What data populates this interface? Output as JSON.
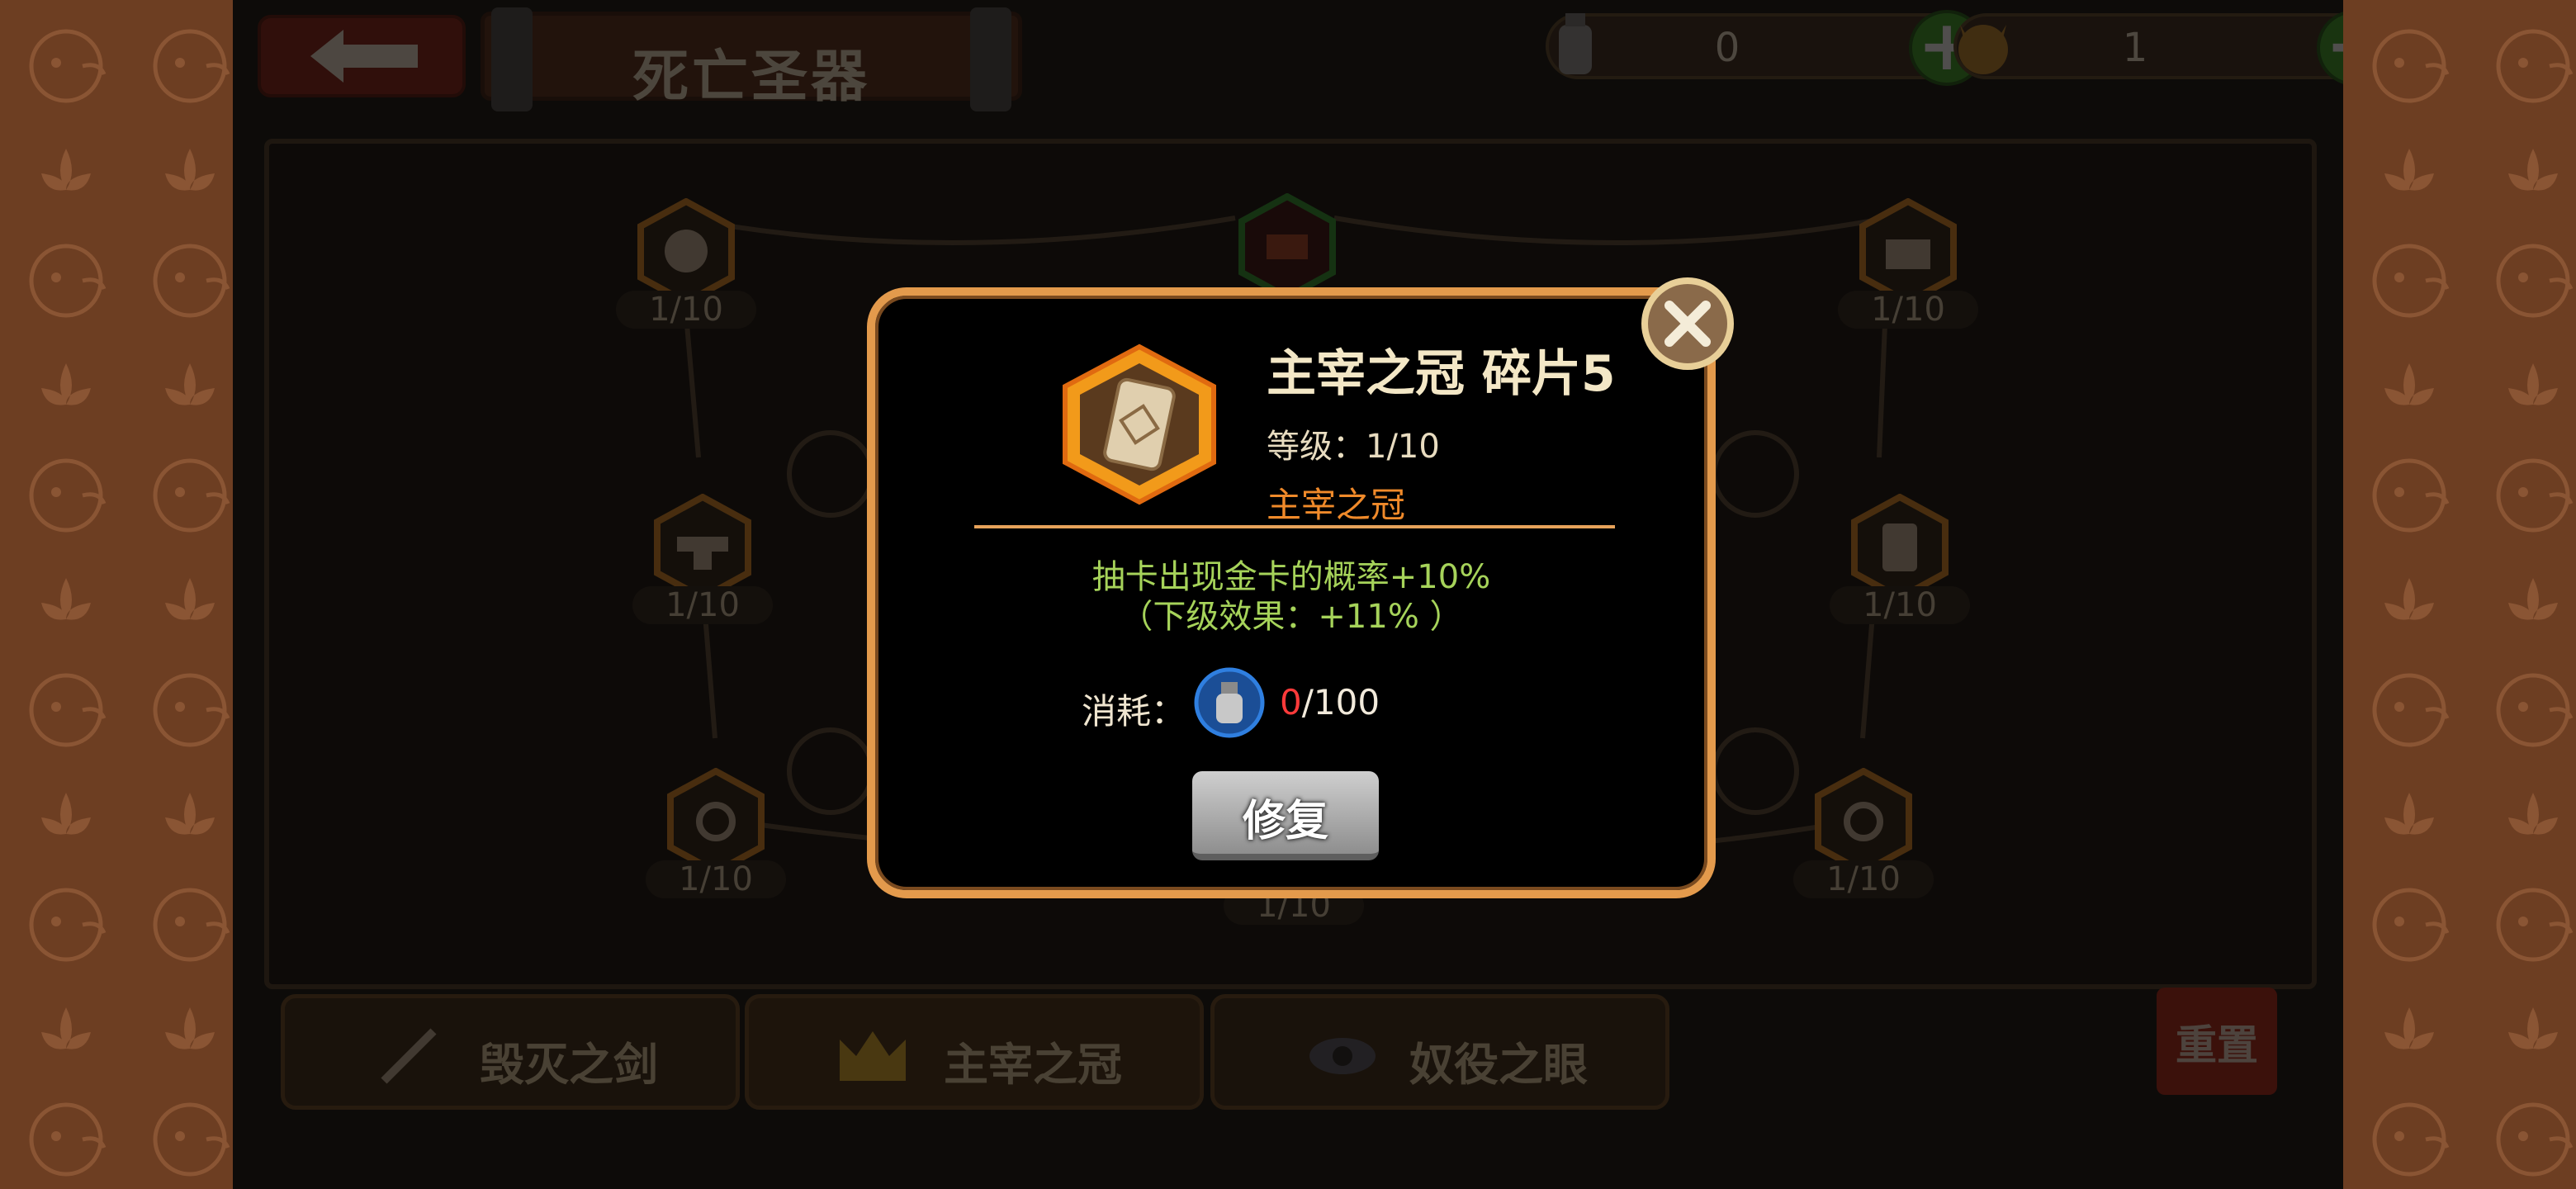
{
  "header": {
    "title": "死亡圣器",
    "resources": [
      {
        "icon": "bottle-icon",
        "value": "0"
      },
      {
        "icon": "demon-head-icon",
        "value": "1"
      }
    ]
  },
  "board": {
    "nodes": [
      {
        "icon": "ghost-icon",
        "level": "1/10"
      },
      {
        "icon": "crown-icon",
        "level": ""
      },
      {
        "icon": "castle-icon",
        "level": "1/10"
      },
      {
        "icon": "anvil-icon",
        "level": "1/10"
      },
      {
        "icon": "card-icon",
        "level": "1/10"
      },
      {
        "icon": "swirl-icon",
        "level": "1/10"
      },
      {
        "icon": "center-icon",
        "level": "1/10"
      },
      {
        "icon": "swirl-icon",
        "level": "1/10"
      }
    ]
  },
  "tabs": [
    {
      "label": "毁灭之剑",
      "icon": "sword-icon"
    },
    {
      "label": "主宰之冠",
      "icon": "crown-icon"
    },
    {
      "label": "奴役之眼",
      "icon": "eye-icon"
    }
  ],
  "reset_label": "重置",
  "modal": {
    "name": "主宰之冠 碎片5",
    "level": "等级：1/10",
    "set_name": "主宰之冠",
    "effect_line1": "抽卡出现金卡的概率+10%",
    "effect_line2": "（下级效果：+11% ）",
    "cost_label": "消耗：",
    "cost_current": "0",
    "cost_sep": "/",
    "cost_total": "100",
    "repair_label": "修复"
  },
  "colors": {
    "accent_orange": "#e39a4c",
    "effect_green": "#a6d35a",
    "set_orange": "#f08a2a",
    "cost_red": "#ff3a3a"
  }
}
